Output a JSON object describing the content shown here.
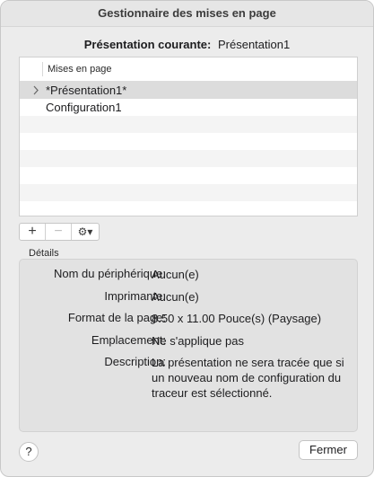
{
  "window": {
    "title": "Gestionnaire des mises en page"
  },
  "current": {
    "label": "Présentation courante:",
    "value": "Présentation1"
  },
  "list": {
    "header": "Mises en page",
    "items": [
      {
        "label": "*Présentation1*",
        "selected": true,
        "expandable": true
      },
      {
        "label": "Configuration1",
        "selected": false,
        "expandable": false
      }
    ]
  },
  "toolbar": {
    "add": "+",
    "remove": "−",
    "gear": "⚙▾"
  },
  "details": {
    "label": "Détails",
    "rows": [
      {
        "key": "Nom du périphérique:",
        "value": "Aucun(e)"
      },
      {
        "key": "Imprimante:",
        "value": "Aucun(e)"
      },
      {
        "key": "Format de la page:",
        "value": "8.50 x 11.00 Pouce(s) (Paysage)"
      },
      {
        "key": "Emplacement:",
        "value": "Ne s'applique pas"
      },
      {
        "key": "Description:",
        "value": "La présentation ne sera tracée que si un nouveau nom de configuration du traceur est sélectionné."
      }
    ]
  },
  "footer": {
    "help": "?",
    "close": "Fermer"
  }
}
